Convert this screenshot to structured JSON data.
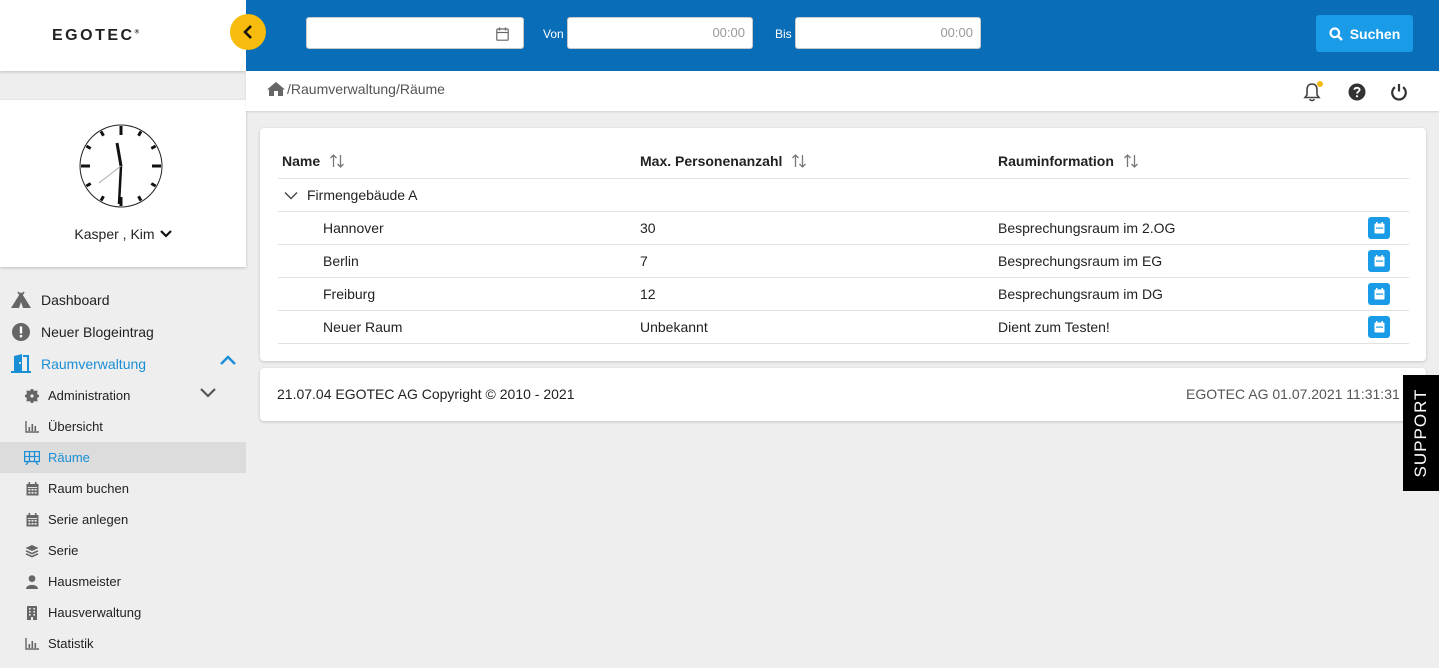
{
  "sidebar": {
    "logo": "EGOTEC",
    "logo_mark": "®",
    "user_name": "Kasper , Kim",
    "items": [
      {
        "label": "Dashboard",
        "icon": "tent-icon"
      },
      {
        "label": "Neuer Blogeintrag",
        "icon": "exclamation-circle-icon"
      },
      {
        "label": "Raumverwaltung",
        "icon": "door-icon"
      }
    ],
    "subitems": [
      {
        "label": "Administration",
        "icon": "gear-icon"
      },
      {
        "label": "Übersicht",
        "icon": "bar-chart-icon"
      },
      {
        "label": "Räume",
        "icon": "grid-icon"
      },
      {
        "label": "Raum buchen",
        "icon": "calendar-icon"
      },
      {
        "label": "Serie anlegen",
        "icon": "calendar-icon"
      },
      {
        "label": "Serie",
        "icon": "layers-icon"
      },
      {
        "label": "Hausmeister",
        "icon": "user-icon"
      },
      {
        "label": "Hausverwaltung",
        "icon": "building-icon"
      },
      {
        "label": "Statistik",
        "icon": "bar-chart-icon"
      }
    ]
  },
  "topbar": {
    "date_value": "",
    "von_label": "Von",
    "von_placeholder": "00:00",
    "bis_label": "Bis",
    "bis_placeholder": "00:00",
    "search_label": "Suchen"
  },
  "breadcrumb": {
    "path": "/Raumverwaltung/Räume"
  },
  "table": {
    "headers": [
      "Name",
      "Max. Personenanzahl",
      "Rauminformation"
    ],
    "group": "Firmengebäude A",
    "rows": [
      {
        "name": "Hannover",
        "capacity": "30",
        "info": "Besprechungsraum im 2.OG"
      },
      {
        "name": "Berlin",
        "capacity": "7",
        "info": "Besprechungsraum im EG"
      },
      {
        "name": "Freiburg",
        "capacity": "12",
        "info": "Besprechungsraum im DG"
      },
      {
        "name": "Neuer Raum",
        "capacity": "Unbekannt",
        "info": "Dient zum Testen!"
      }
    ]
  },
  "footer": {
    "copyright": "21.07.04 EGOTEC AG Copyright © 2010 - 2021",
    "status": "EGOTEC AG  01.07.2021 11:31:31"
  },
  "support_label": "SUPPORT",
  "colors": {
    "primary": "#0a6db8",
    "accent": "#1a9be8",
    "highlight": "#f6bb0c",
    "active_text": "#1a8fd6"
  }
}
